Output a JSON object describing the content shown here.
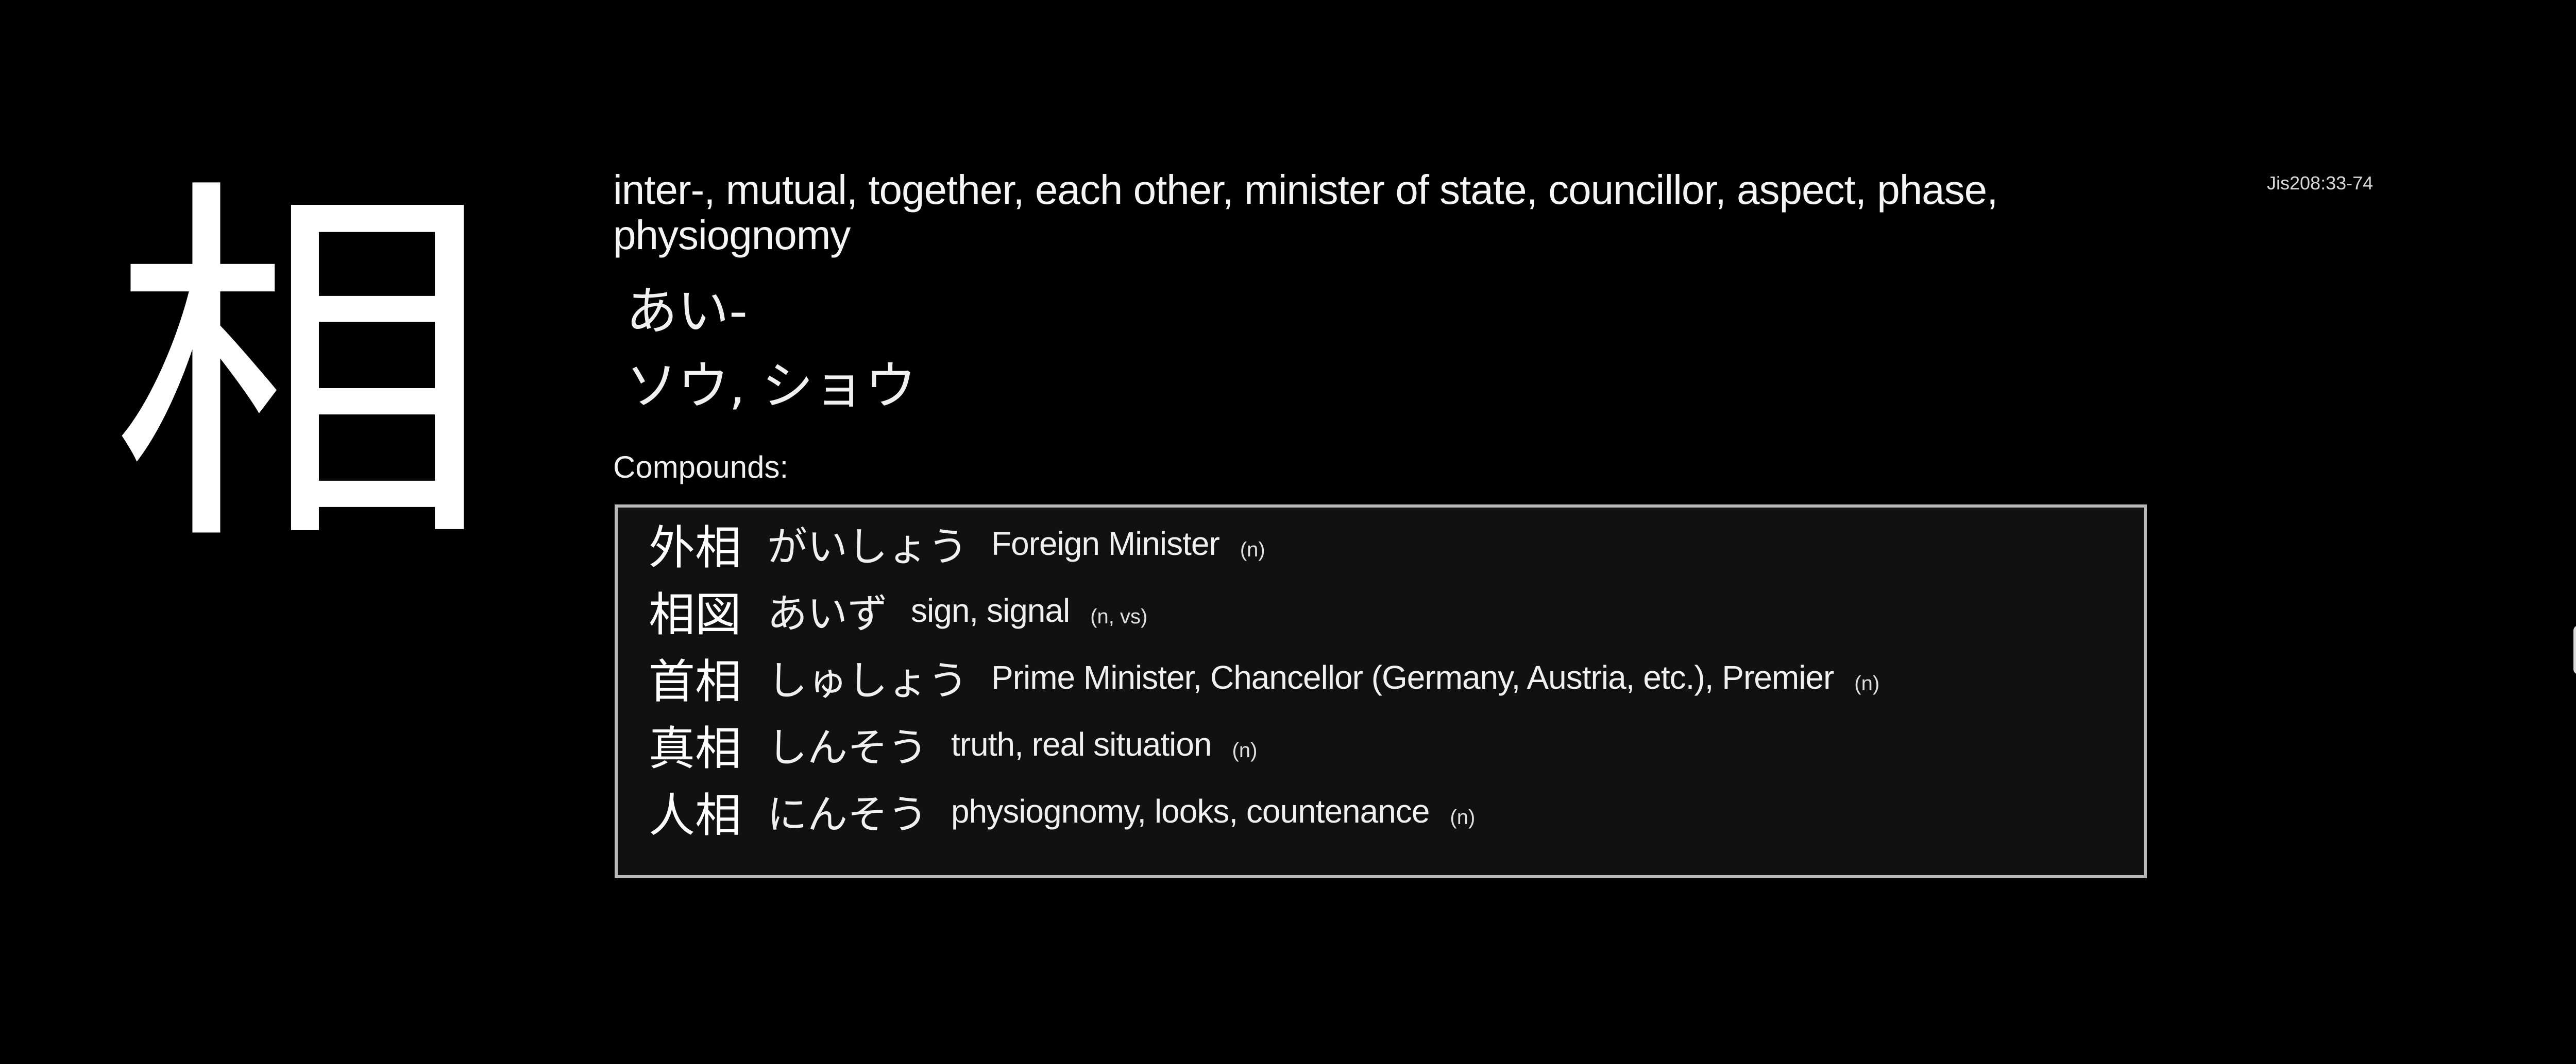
{
  "kanji": "相",
  "meanings": "inter-, mutual, together, each other, minister of state, councillor, aspect, phase, physiognomy",
  "kun_reading": "あい-",
  "on_reading": "ソウ, ショウ",
  "jis_code": "Jis208:33-74",
  "compounds_label": "Compounds:",
  "compounds": [
    {
      "word": "外相",
      "reading": "がいしょう",
      "definition": "Foreign Minister",
      "pos": "(n)"
    },
    {
      "word": "相図",
      "reading": "あいず",
      "definition": "sign, signal",
      "pos": "(n, vs)"
    },
    {
      "word": "首相",
      "reading": "しゅしょう",
      "definition": "Prime Minister, Chancellor (Germany, Austria, etc.), Premier",
      "pos": "(n)"
    },
    {
      "word": "真相",
      "reading": "しんそう",
      "definition": "truth, real situation",
      "pos": "(n)"
    },
    {
      "word": "人相",
      "reading": "にんそう",
      "definition": "physiognomy, looks, countenance",
      "pos": "(n)"
    }
  ],
  "colors": {
    "background": "#000000",
    "box_background": "#111111",
    "box_border": "#b9b9b9",
    "text": "#f2f2f2"
  }
}
